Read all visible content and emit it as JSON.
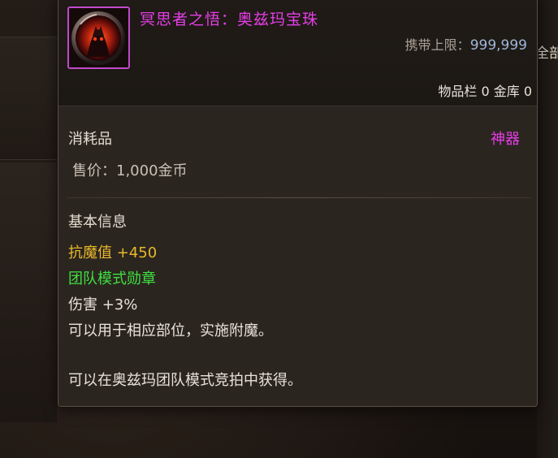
{
  "background": {
    "right_edge_text": "全部"
  },
  "tooltip": {
    "item_name": "冥思者之悟：奥兹玛宝珠",
    "icon": "ozma-orb-icon",
    "carry_limit_label": "携带上限：",
    "carry_limit_value": "999,999",
    "storage_counts": "物品栏 0 金库 0",
    "category": "消耗品",
    "rarity": "神器",
    "price": "售价：1,000金币",
    "section_title": "基本信息",
    "stats": {
      "magic_resist": "抗魔值 +450",
      "badge_type": "团队模式勋章",
      "damage": "伤害 +3%",
      "description": "可以用于相应部位，实施附魔。",
      "obtain": "可以在奥兹玛团队模式竞拍中获得。"
    },
    "colors": {
      "rarity_color": "#e63ee6",
      "magic_resist_color": "#e8b92a",
      "badge_color": "#3fe03f",
      "carry_value_color": "#9fb6d6"
    }
  }
}
